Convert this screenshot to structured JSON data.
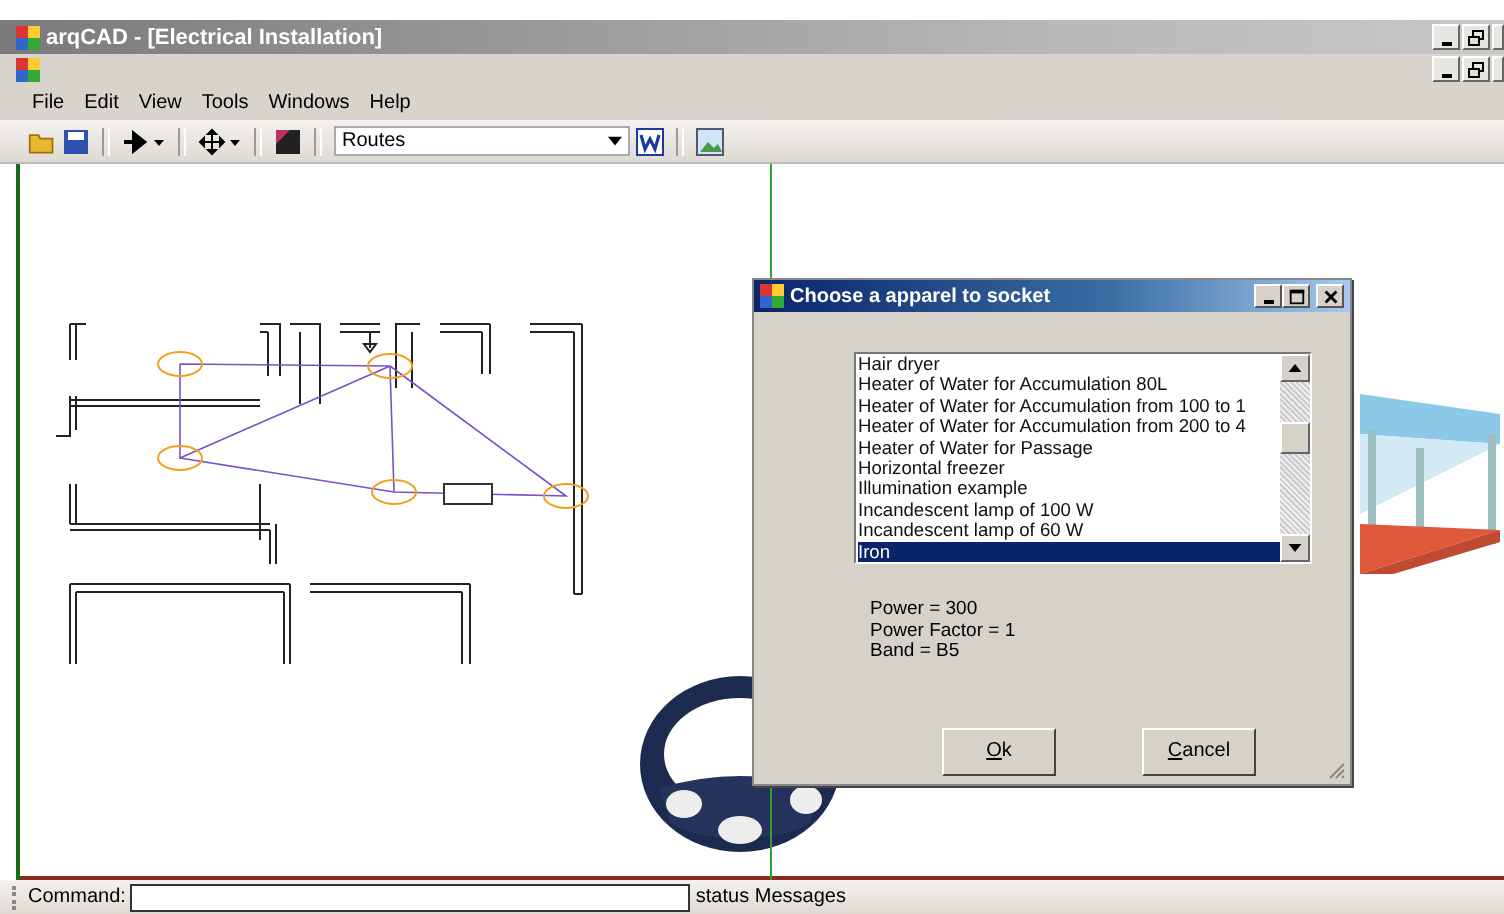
{
  "window": {
    "title": "arqCAD - [Electrical Installation]"
  },
  "menu": [
    {
      "label": "File"
    },
    {
      "label": "Edit"
    },
    {
      "label": "View"
    },
    {
      "label": "Tools"
    },
    {
      "label": "Windows"
    },
    {
      "label": "Help"
    }
  ],
  "toolbar": {
    "layer_select": "Routes"
  },
  "dialog": {
    "title": "Choose a apparel to socket",
    "items": [
      {
        "label": "Hair dryer",
        "selected": false
      },
      {
        "label": "Heater of Water for Accumulation 80L",
        "selected": false
      },
      {
        "label": "Heater of Water for Accumulation from 100 to 1",
        "selected": false
      },
      {
        "label": "Heater of Water for Accumulation from 200 to 4",
        "selected": false
      },
      {
        "label": "Heater of Water for Passage",
        "selected": false
      },
      {
        "label": "Horizontal freezer",
        "selected": false
      },
      {
        "label": "Illumination example",
        "selected": false
      },
      {
        "label": "Incandescent lamp of 100 W",
        "selected": false
      },
      {
        "label": "Incandescent lamp of 60 W",
        "selected": false
      },
      {
        "label": "Iron",
        "selected": true
      }
    ],
    "details": [
      "Power = 300",
      "Power Factor = 1",
      "Band = B5"
    ],
    "buttons": [
      {
        "label": "Ok"
      },
      {
        "label": "Cancel"
      }
    ]
  },
  "status_bar": {
    "command_label": "Command:",
    "message": "status Messages"
  }
}
